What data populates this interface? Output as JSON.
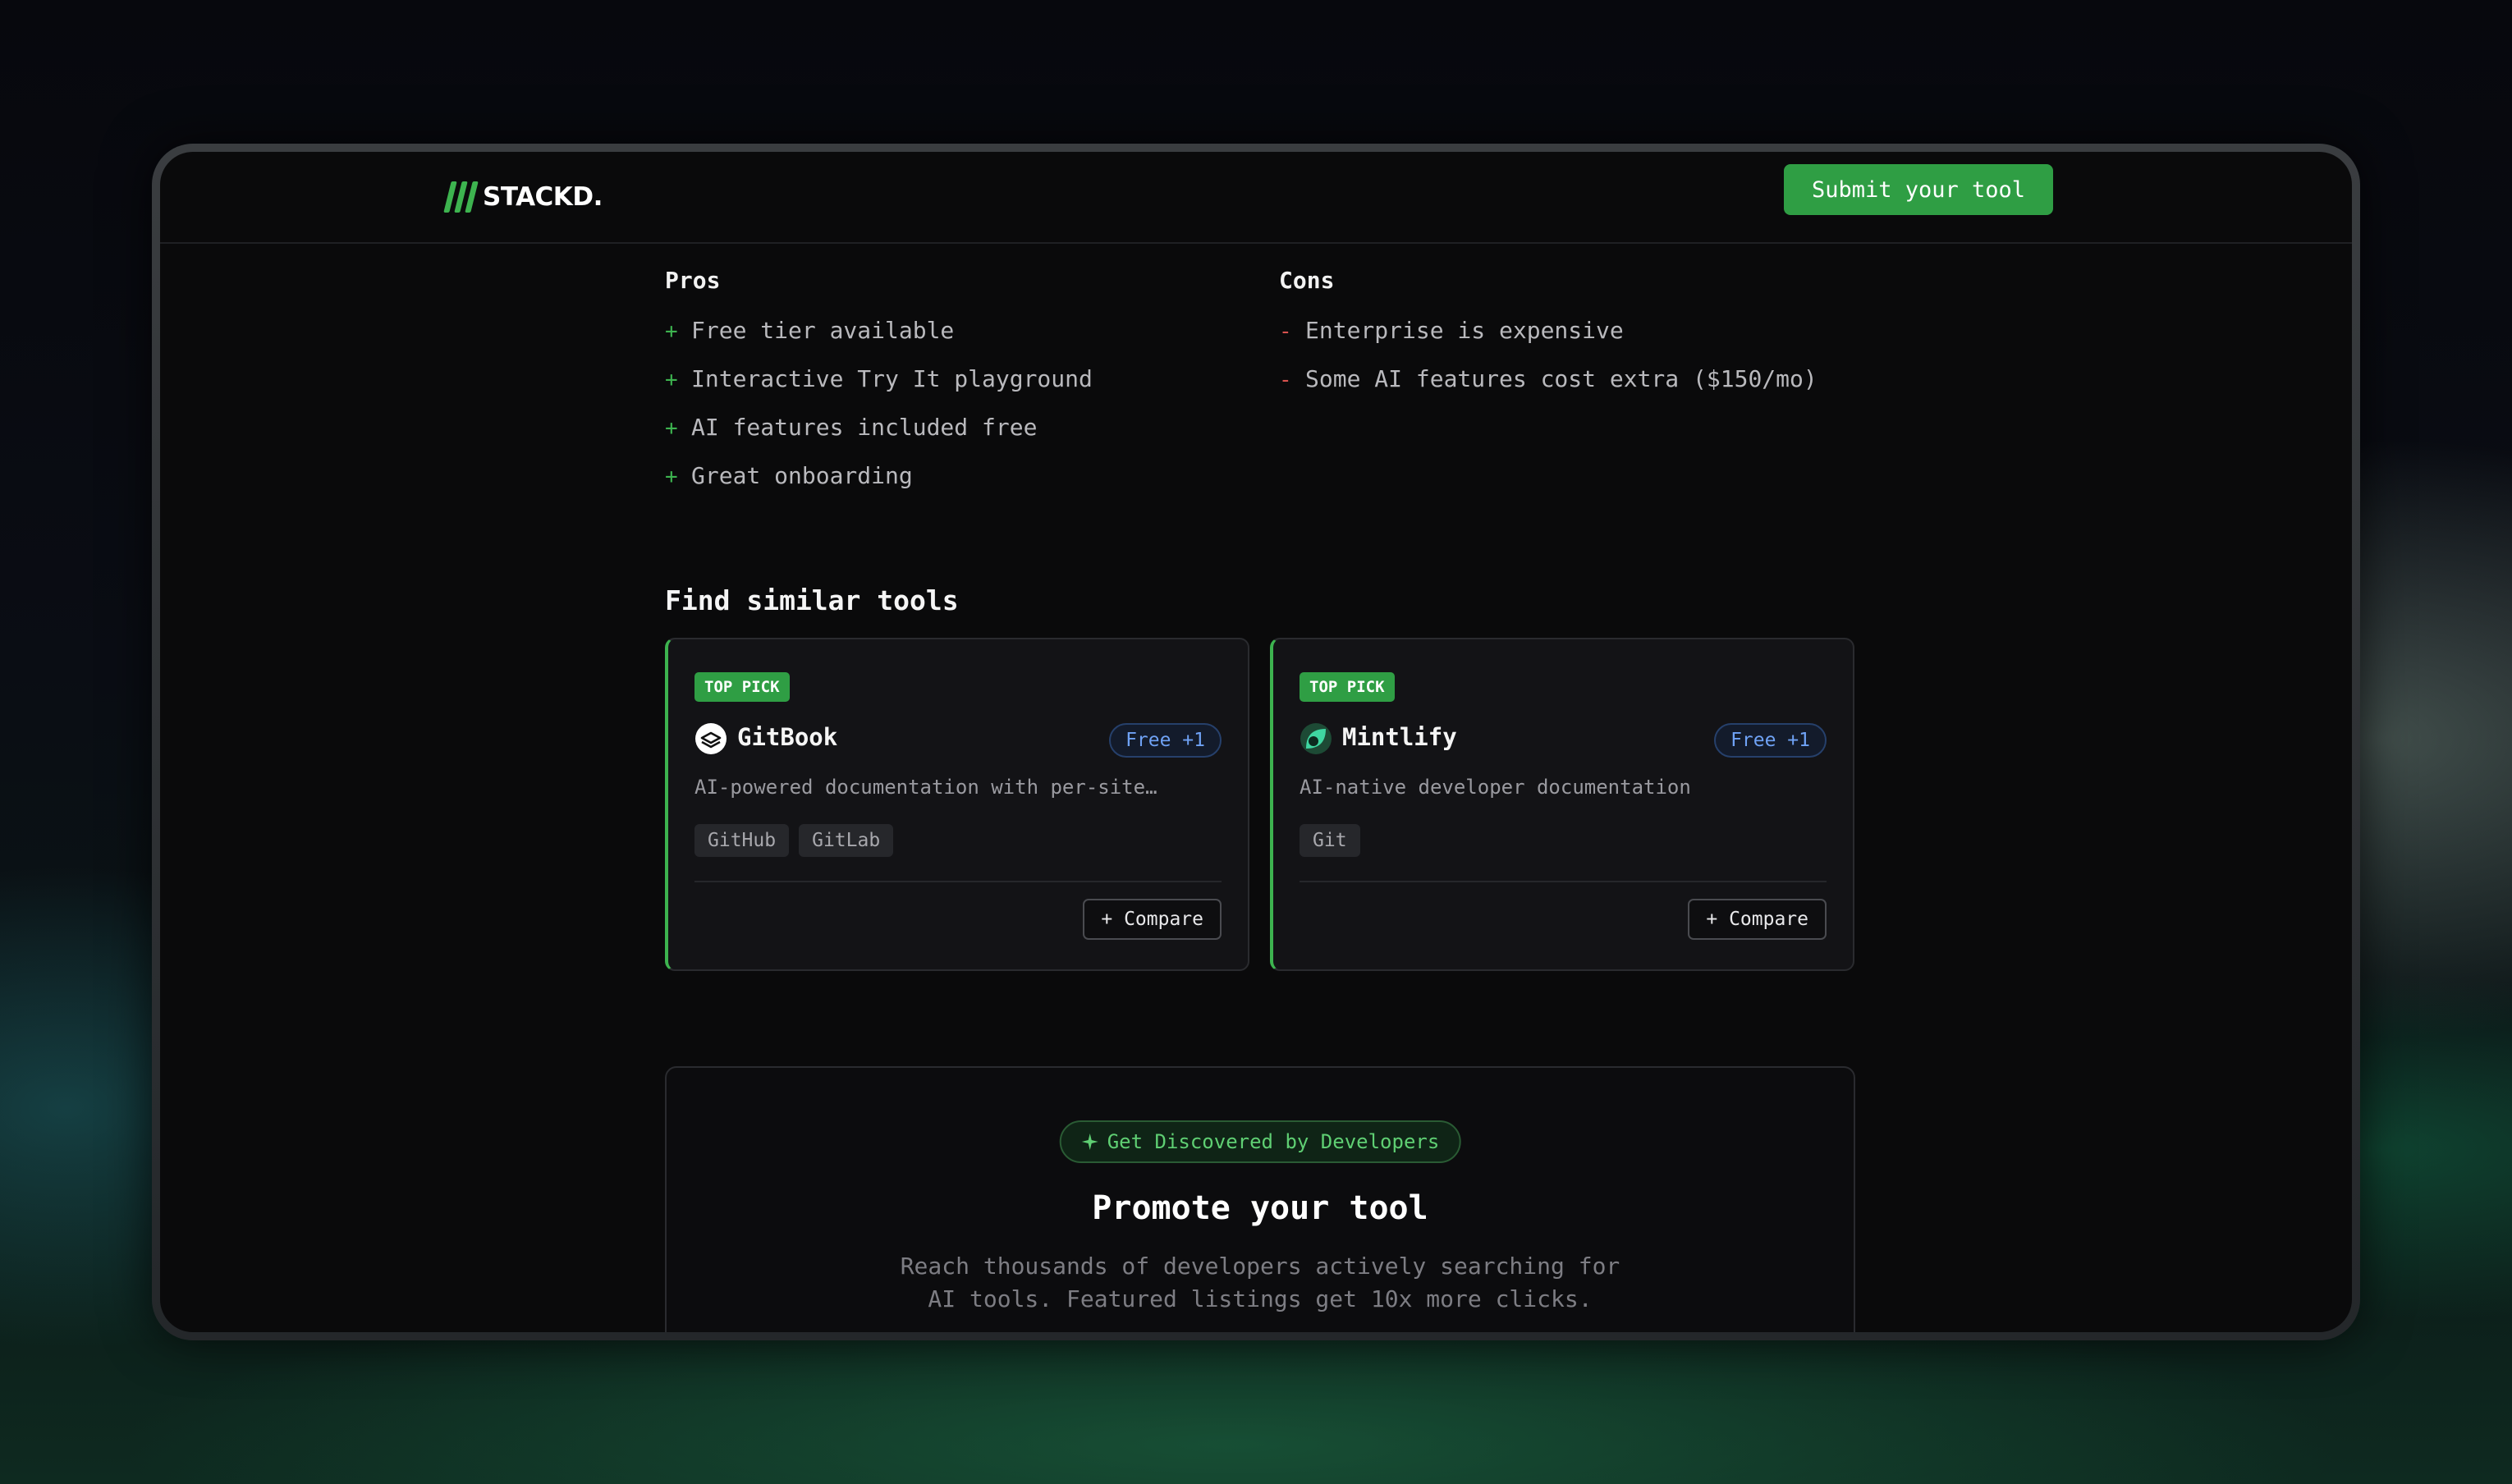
{
  "header": {
    "logo_text": "STACKD.",
    "submit_label": "Submit your tool"
  },
  "pros": {
    "heading": "Pros",
    "items": [
      "Free tier available",
      "Interactive Try It playground",
      "AI features included free",
      "Great onboarding"
    ]
  },
  "cons": {
    "heading": "Cons",
    "items": [
      "Enterprise is expensive",
      "Some AI features cost extra ($150/mo)"
    ]
  },
  "similar": {
    "title": "Find similar tools",
    "cards": [
      {
        "badge": "TOP PICK",
        "name": "GitBook",
        "icon": "gitbook-logo-icon",
        "price": "Free +1",
        "description": "AI-powered documentation with per-site…",
        "tags": [
          "GitHub",
          "GitLab"
        ],
        "compare_label": "+ Compare"
      },
      {
        "badge": "TOP PICK",
        "name": "Mintlify",
        "icon": "mintlify-logo-icon",
        "price": "Free +1",
        "description": "AI-native developer documentation",
        "tags": [
          "Git"
        ],
        "compare_label": "+ Compare"
      }
    ]
  },
  "promo": {
    "pill_icon": "sparkle-icon",
    "pill_label": "Get Discovered by Developers",
    "title": "Promote your tool",
    "text_line1": "Reach thousands of developers actively searching for",
    "text_line2": "AI tools. Featured listings get 10x more clicks."
  },
  "colors": {
    "accent": "#2f9e44",
    "accent_light": "#3db34f",
    "price_badge": "#6fa2f5",
    "con_mark": "#d9534f"
  }
}
